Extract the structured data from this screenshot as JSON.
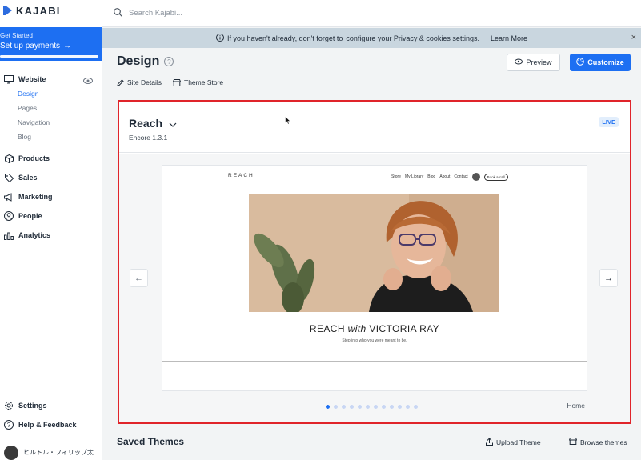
{
  "brand": {
    "name": "KAJABI",
    "accent": "#1d6ff2"
  },
  "get_started": {
    "small": "Get Started",
    "main": "Set up payments"
  },
  "sidebar": {
    "website": "Website",
    "sub": [
      "Design",
      "Pages",
      "Navigation",
      "Blog"
    ],
    "items": [
      "Products",
      "Sales",
      "Marketing",
      "People",
      "Analytics"
    ],
    "bottom": [
      "Settings",
      "Help & Feedback"
    ],
    "user": "ヒルトル・フィリップ太..."
  },
  "search": {
    "placeholder": "Search Kajabi..."
  },
  "banner": {
    "pre": "If you haven't already, don't forget to",
    "link": "configure your Privacy & cookies settings.",
    "learn": "Learn More",
    "close": "×"
  },
  "page": {
    "title": "Design",
    "links": [
      "Site Details",
      "Theme Store"
    ]
  },
  "buttons": {
    "preview": "Preview",
    "customize": "Customize"
  },
  "theme": {
    "name": "Reach",
    "version": "Encore 1.3.1",
    "status": "LIVE"
  },
  "site_preview": {
    "logo": "REACH",
    "nav": [
      "Store",
      "My Library",
      "Blog",
      "About",
      "Contact"
    ],
    "cta": "Book a call",
    "title_a": "REACH",
    "title_b": "with",
    "title_c": "VICTORIA RAY",
    "tagline": "Step into who you were meant to be."
  },
  "carousel": {
    "page_label": "Home",
    "total": 12,
    "active": 0
  },
  "saved": {
    "title": "Saved Themes",
    "upload": "Upload Theme",
    "browse": "Browse themes"
  }
}
